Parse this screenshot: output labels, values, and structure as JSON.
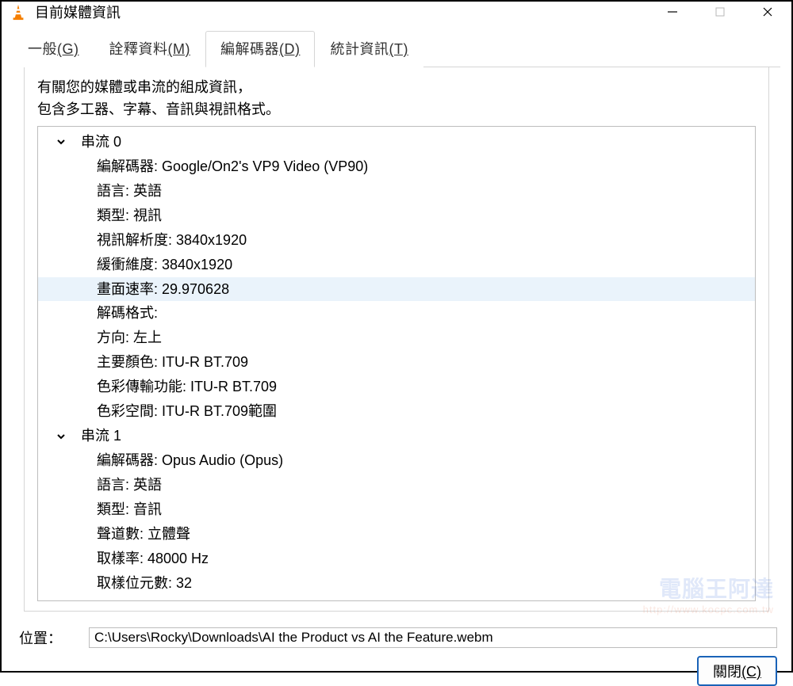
{
  "window": {
    "title": "目前媒體資訊"
  },
  "tabs": {
    "general": "一般",
    "general_key": "(G)",
    "metadata": "詮釋資料",
    "metadata_key": "(M)",
    "codec": "編解碼器",
    "codec_key": "(D)",
    "stats": "統計資訊",
    "stats_key": "(T)"
  },
  "description": {
    "line1": "有關您的媒體或串流的組成資訊，",
    "line2": "包含多工器、字幕、音訊與視訊格式。"
  },
  "streams": [
    {
      "header": "串流 0",
      "props": [
        {
          "label": "編解碼器",
          "value": "Google/On2's VP9 Video (VP90)"
        },
        {
          "label": "語言",
          "value": "英語"
        },
        {
          "label": "類型",
          "value": "視訊"
        },
        {
          "label": "視訊解析度",
          "value": "3840x1920"
        },
        {
          "label": "緩衝維度",
          "value": "3840x1920"
        },
        {
          "label": "畫面速率",
          "value": "29.970628",
          "selected": true
        },
        {
          "label": "解碼格式",
          "value": ""
        },
        {
          "label": "方向",
          "value": "左上"
        },
        {
          "label": "主要顏色",
          "value": "ITU-R BT.709"
        },
        {
          "label": "色彩傳輸功能",
          "value": "ITU-R BT.709"
        },
        {
          "label": "色彩空間",
          "value": "ITU-R BT.709範圍"
        }
      ]
    },
    {
      "header": "串流 1",
      "props": [
        {
          "label": "編解碼器",
          "value": "Opus Audio (Opus)"
        },
        {
          "label": "語言",
          "value": "英語"
        },
        {
          "label": "類型",
          "value": "音訊"
        },
        {
          "label": "聲道數",
          "value": "立體聲"
        },
        {
          "label": "取樣率",
          "value": "48000 Hz"
        },
        {
          "label": "取樣位元數",
          "value": "32"
        }
      ]
    }
  ],
  "footer": {
    "location_label": "位置：",
    "location_value": "C:\\Users\\Rocky\\Downloads\\AI the Product vs AI the Feature.webm",
    "close_label": "關閉",
    "close_key": "(C)"
  },
  "watermark": {
    "text": "電腦王阿達",
    "url": "http://www.kocpc.com.tw"
  }
}
